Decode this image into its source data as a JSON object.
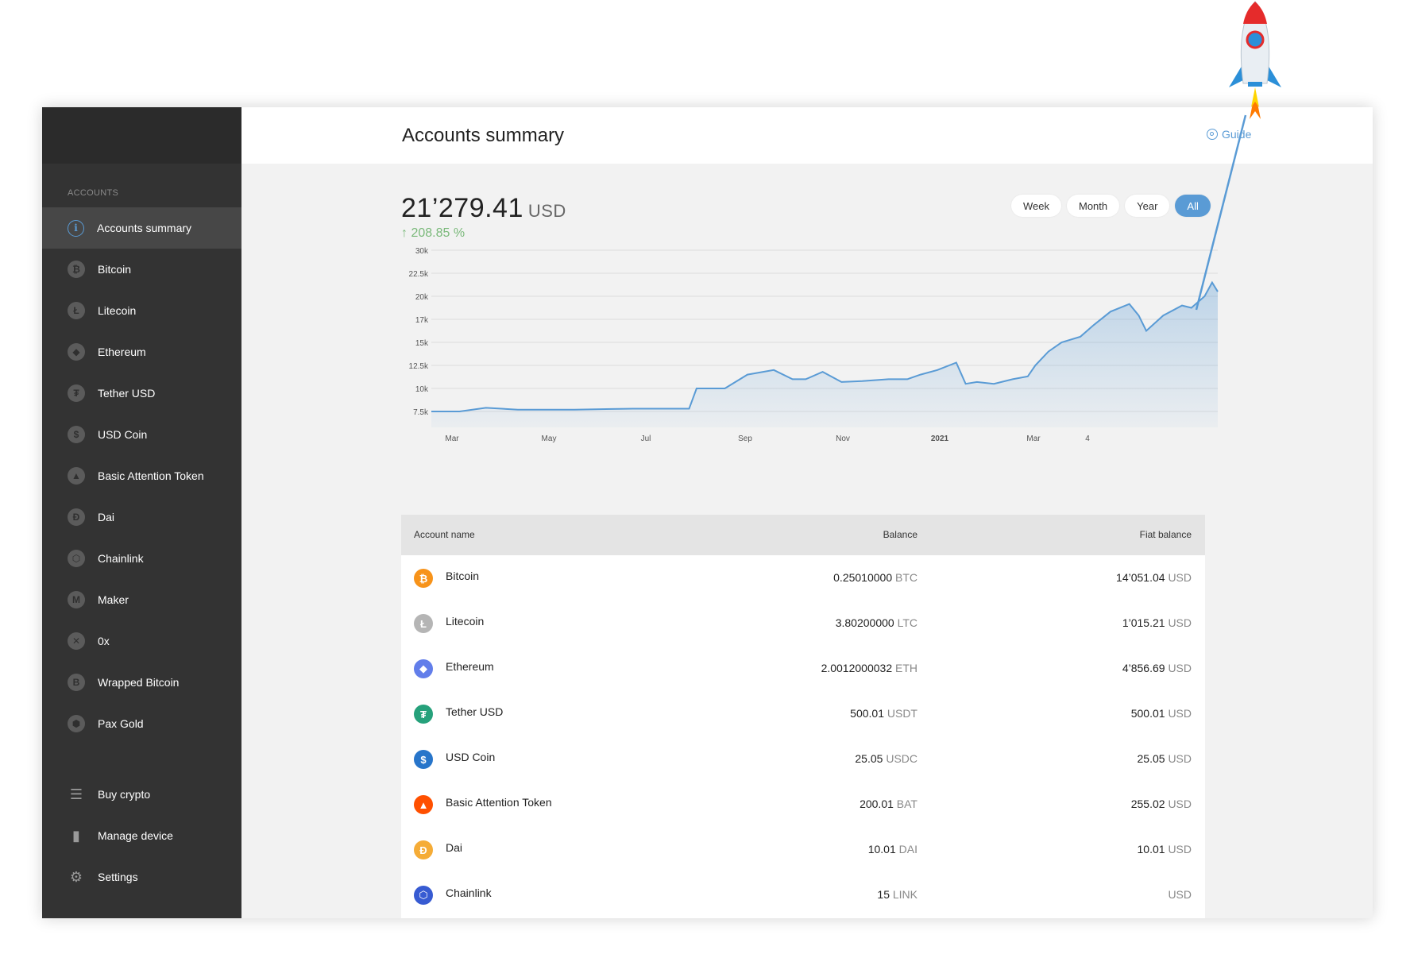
{
  "sidebar": {
    "section_label": "ACCOUNTS",
    "items": [
      {
        "label": "Accounts summary",
        "icon": "info-icon",
        "glyph": "i",
        "active": true
      },
      {
        "label": "Bitcoin",
        "icon": "bitcoin-icon",
        "glyph": "₿"
      },
      {
        "label": "Litecoin",
        "icon": "litecoin-icon",
        "glyph": "Ł"
      },
      {
        "label": "Ethereum",
        "icon": "ethereum-icon",
        "glyph": "◆"
      },
      {
        "label": "Tether USD",
        "icon": "tether-icon",
        "glyph": "₮"
      },
      {
        "label": "USD Coin",
        "icon": "usd-coin-icon",
        "glyph": "$"
      },
      {
        "label": "Basic Attention Token",
        "icon": "bat-icon",
        "glyph": "▲"
      },
      {
        "label": "Dai",
        "icon": "dai-icon",
        "glyph": "Ð"
      },
      {
        "label": "Chainlink",
        "icon": "chainlink-icon",
        "glyph": "⬡"
      },
      {
        "label": "Maker",
        "icon": "maker-icon",
        "glyph": "M"
      },
      {
        "label": "0x",
        "icon": "0x-icon",
        "glyph": "✕"
      },
      {
        "label": "Wrapped Bitcoin",
        "icon": "wrapped-bitcoin-icon",
        "glyph": "B"
      },
      {
        "label": "Pax Gold",
        "icon": "pax-gold-icon",
        "glyph": "⬢"
      }
    ],
    "bottom_items": [
      {
        "label": "Buy crypto",
        "icon": "coins-icon",
        "glyph": "☰"
      },
      {
        "label": "Manage device",
        "icon": "device-icon",
        "glyph": "▮"
      },
      {
        "label": "Settings",
        "icon": "gear-icon",
        "glyph": "⚙"
      }
    ]
  },
  "header": {
    "title": "Accounts summary",
    "guide_label": "Guide"
  },
  "summary": {
    "balance": "21’279.41",
    "currency": "USD",
    "change": "↑ 208.85 %",
    "ranges": [
      {
        "label": "Week",
        "active": false
      },
      {
        "label": "Month",
        "active": false
      },
      {
        "label": "Year",
        "active": false
      },
      {
        "label": "All",
        "active": true
      }
    ]
  },
  "chart_data": {
    "type": "area",
    "y_ticks": [
      "30k",
      "22.5k",
      "20k",
      "17k",
      "15k",
      "12.5k",
      "10k",
      "7.5k"
    ],
    "x_ticks": [
      "Mar",
      "May",
      "Jul",
      "Sep",
      "Nov",
      "2021",
      "Mar",
      "4"
    ],
    "x": [
      "2020-02-15",
      "2020-03-01",
      "2020-03-15",
      "2020-04-01",
      "2020-05-01",
      "2020-06-01",
      "2020-07-01",
      "2020-07-05",
      "2020-07-20",
      "2020-08-01",
      "2020-08-15",
      "2020-08-25",
      "2020-09-01",
      "2020-09-10",
      "2020-09-20",
      "2020-10-01",
      "2020-10-15",
      "2020-10-25",
      "2020-11-01",
      "2020-11-10",
      "2020-11-20",
      "2020-11-25",
      "2020-12-01",
      "2020-12-10",
      "2020-12-20",
      "2020-12-28",
      "2021-01-01",
      "2021-01-08",
      "2021-01-15",
      "2021-01-25",
      "2021-02-01",
      "2021-02-10",
      "2021-02-20",
      "2021-02-25",
      "2021-03-01",
      "2021-03-10",
      "2021-03-20",
      "2021-03-25",
      "2021-04-01",
      "2021-04-05",
      "2021-04-08"
    ],
    "values": [
      7500,
      7500,
      7900,
      7700,
      7700,
      7800,
      7800,
      10000,
      10000,
      11500,
      12000,
      11000,
      11000,
      11800,
      10700,
      10800,
      11000,
      11000,
      11500,
      12000,
      12800,
      10500,
      10700,
      10500,
      11000,
      11300,
      12500,
      14000,
      15000,
      15500,
      16500,
      18000,
      19000,
      17500,
      16000,
      17500,
      18800,
      18500,
      20000,
      21500,
      20500
    ],
    "ylim": [
      7000,
      30000
    ],
    "grid": true,
    "color": "#5a9bd5"
  },
  "table": {
    "headers": {
      "name": "Account name",
      "balance": "Balance",
      "fiat": "Fiat balance"
    },
    "rows": [
      {
        "name": "Bitcoin",
        "balance": "0.25010000",
        "unit": "BTC",
        "fiat": "14’051.04",
        "fiat_unit": "USD",
        "color": "#f7931a",
        "glyph": "₿",
        "icon": "bitcoin-icon"
      },
      {
        "name": "Litecoin",
        "balance": "3.80200000",
        "unit": "LTC",
        "fiat": "1’015.21",
        "fiat_unit": "USD",
        "color": "#b5b5b5",
        "glyph": "Ł",
        "icon": "litecoin-icon"
      },
      {
        "name": "Ethereum",
        "balance": "2.0012000032",
        "unit": "ETH",
        "fiat": "4’856.69",
        "fiat_unit": "USD",
        "color": "#627eea",
        "glyph": "◆",
        "icon": "ethereum-icon"
      },
      {
        "name": "Tether USD",
        "balance": "500.01",
        "unit": "USDT",
        "fiat": "500.01",
        "fiat_unit": "USD",
        "color": "#26a17b",
        "glyph": "₮",
        "icon": "tether-icon"
      },
      {
        "name": "USD Coin",
        "balance": "25.05",
        "unit": "USDC",
        "fiat": "25.05",
        "fiat_unit": "USD",
        "color": "#2775ca",
        "glyph": "$",
        "icon": "usd-coin-icon"
      },
      {
        "name": "Basic Attention Token",
        "balance": "200.01",
        "unit": "BAT",
        "fiat": "255.02",
        "fiat_unit": "USD",
        "color": "#ff5000",
        "glyph": "▲",
        "icon": "bat-icon"
      },
      {
        "name": "Dai",
        "balance": "10.01",
        "unit": "DAI",
        "fiat": "10.01",
        "fiat_unit": "USD",
        "color": "#f5ac37",
        "glyph": "Ð",
        "icon": "dai-icon"
      },
      {
        "name": "Chainlink",
        "balance": "15",
        "unit": "LINK",
        "fiat": "",
        "fiat_unit": "USD",
        "color": "#375bd2",
        "glyph": "⬡",
        "icon": "chainlink-icon"
      }
    ]
  }
}
